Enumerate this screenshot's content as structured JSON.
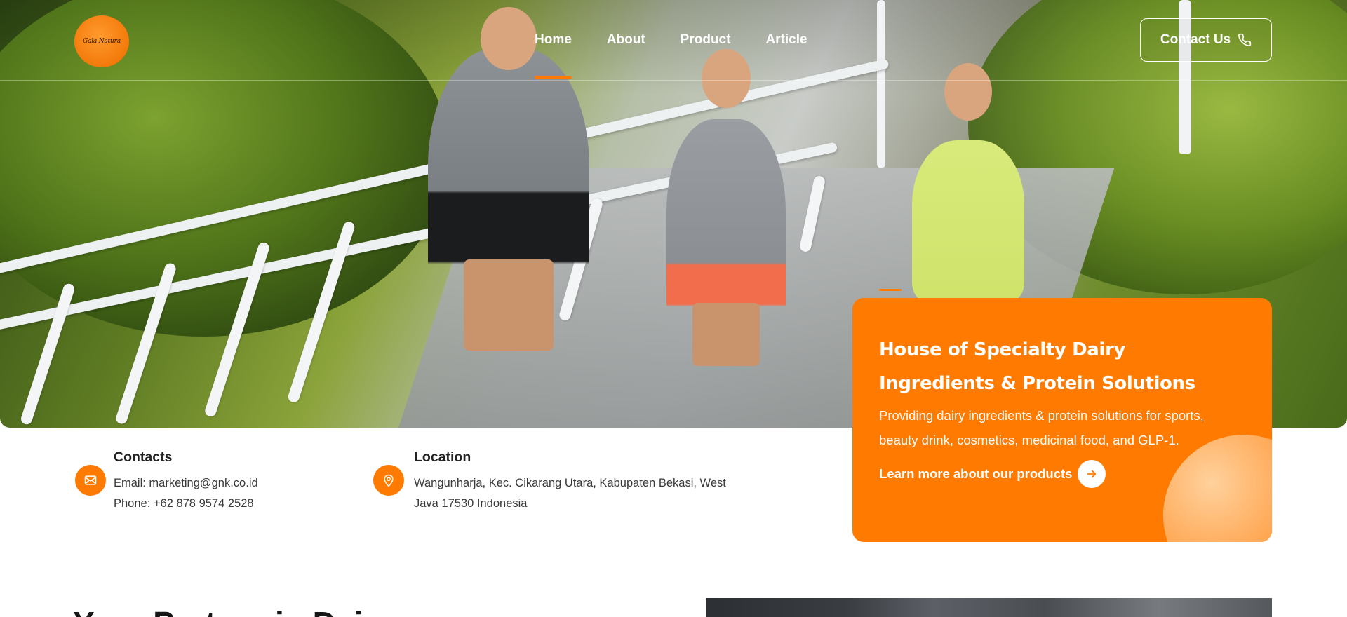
{
  "brand": {
    "logo_text": "Gala Natura"
  },
  "nav": {
    "items": [
      {
        "label": "Home",
        "active": true
      },
      {
        "label": "About",
        "active": false
      },
      {
        "label": "Product",
        "active": false
      },
      {
        "label": "Article",
        "active": false
      }
    ],
    "contact_label": "Contact Us"
  },
  "hero": {
    "card": {
      "title_line1": "House of Specialty Dairy",
      "title_line2": "Ingredients & Protein Solutions",
      "description": "Providing dairy ingredients & protein solutions for sports, beauty drink, cosmetics, medicinal food, and GLP-1.",
      "cta_label": "Learn more about our products"
    }
  },
  "contacts": {
    "title": "Contacts",
    "email": "Email: marketing@gnk.co.id",
    "phone": "Phone: +62 878 9574 2528"
  },
  "location": {
    "title": "Location",
    "line1": "Wangunharja, Kec. Cikarang Utara, Kabupaten Bekasi, West",
    "line2": "Java 17530 Indonesia"
  },
  "next_section": {
    "heading_partial": "Your Partner in Dairy"
  },
  "colors": {
    "accent": "#ff7a00",
    "text": "#2b2b2b",
    "white": "#ffffff"
  },
  "icons": {
    "phone": "phone-icon",
    "email": "mail-icon",
    "location": "map-pin-icon",
    "arrow": "arrow-right-icon"
  }
}
